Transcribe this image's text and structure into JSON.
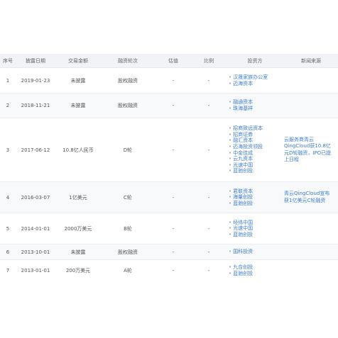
{
  "table": {
    "headers": [
      "序号",
      "披露日期",
      "交易金额",
      "融资轮次",
      "估值",
      "比例",
      "投资方",
      "新闻来源"
    ],
    "rows": [
      {
        "no": "1",
        "date": "2019-01-23",
        "amount": "未披露",
        "round": "股权融资",
        "valuation": "-",
        "ratio": "-",
        "investors": [
          "汉晟家族办公室",
          "迈海资本"
        ],
        "news": ""
      },
      {
        "no": "2",
        "date": "2018-11-21",
        "amount": "未披露",
        "round": "股权融资",
        "valuation": "-",
        "ratio": "-",
        "investors": [
          "融通资本",
          "珠海基祥"
        ],
        "news": ""
      },
      {
        "no": "3",
        "date": "2017-06-12",
        "amount": "10.8亿人民币",
        "round": "D轮",
        "valuation": "-",
        "ratio": "-",
        "investors": [
          "招商致远资本",
          "招商证券",
          "融汇资本",
          "迈海投资领投",
          "中金佳成",
          "云九资本",
          "光速中国",
          "蓝驰创投"
        ],
        "news": "云服务商青云QingCloud获10.8亿元D轮融资，IPO已提上日程"
      },
      {
        "no": "4",
        "date": "2016-03-07",
        "amount": "1亿美元",
        "round": "C轮",
        "valuation": "-",
        "ratio": "-",
        "investors": [
          "君联资本",
          "海量创投",
          "蓝驰创投"
        ],
        "news": "青云QingCloud宣布获1亿美元C轮融资"
      },
      {
        "no": "5",
        "date": "2014-01-01",
        "amount": "2000万美元",
        "round": "B轮",
        "valuation": "-",
        "ratio": "-",
        "investors": [
          "经纬中国",
          "光速中国",
          "蓝驰创投"
        ],
        "news": ""
      },
      {
        "no": "6",
        "date": "2013-10-01",
        "amount": "未披露",
        "round": "股权融资",
        "valuation": "-",
        "ratio": "-",
        "investors": [
          "国科投资"
        ],
        "news": ""
      },
      {
        "no": "7",
        "date": "2013-01-01",
        "amount": "200万美元",
        "round": "A轮",
        "valuation": "-",
        "ratio": "-",
        "investors": [
          "九合创投",
          "蓝驰创投"
        ],
        "news": ""
      }
    ]
  }
}
